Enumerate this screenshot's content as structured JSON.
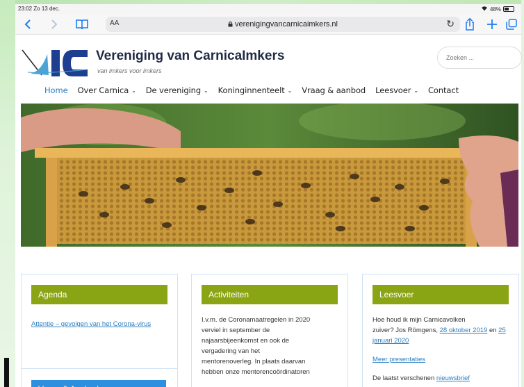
{
  "status_bar": {
    "time": "23:02",
    "date": "Zo 13 dec.",
    "wifi_icon": "wifi-icon",
    "battery": "48%"
  },
  "browser": {
    "text_size_label": "AA",
    "url": "verenigingvancarnicaimkers.nl"
  },
  "site": {
    "title": "Vereniging van CarnicaImkers",
    "tagline": "van imkers voor imkers",
    "search_placeholder": "Zoeken ...",
    "logo": "logo-icon"
  },
  "nav": {
    "items": [
      {
        "label": "Home",
        "active": true,
        "dropdown": false
      },
      {
        "label": "Over Carnica",
        "active": false,
        "dropdown": true
      },
      {
        "label": "De vereniging",
        "active": false,
        "dropdown": true
      },
      {
        "label": "Koninginnenteelt",
        "active": false,
        "dropdown": true
      },
      {
        "label": "Vraag & aanbod",
        "active": false,
        "dropdown": false
      },
      {
        "label": "Leesvoer",
        "active": false,
        "dropdown": true
      },
      {
        "label": "Contact",
        "active": false,
        "dropdown": false
      }
    ]
  },
  "widgets": {
    "agenda": {
      "title": "Agenda",
      "link": "Attentie – gevolgen van het Corona-virus"
    },
    "activiteiten": {
      "title": "Activiteiten",
      "lines": [
        "I.v.m. de Coronamaatregelen in 2020",
        "verviel in september de",
        "najaarsbijeenkomst en ook de",
        "vergadering van het",
        "mentorenoverleg. In plaats daarvan",
        "hebben onze mentorencoördinatoren"
      ]
    },
    "leesvoer": {
      "title": "Leesvoer",
      "text1": "Hoe houd ik mijn Carnicavolken",
      "text2": "zuiver? Jos Römgens,",
      "link1": "28 oktober 2019",
      "and": "en",
      "link2": "25 januari 2020",
      "more_link": "Meer presentaties",
      "last_text": "De laatst verschenen",
      "last_link": "nieuwsbrief"
    },
    "vraag": {
      "title": "Vraag & Aanbod"
    }
  },
  "colors": {
    "widget_header_green": "#8aa514",
    "widget_header_blue": "#2c8fe0",
    "link_blue": "#2a7ec0",
    "browser_accent": "#1e7cf2"
  }
}
